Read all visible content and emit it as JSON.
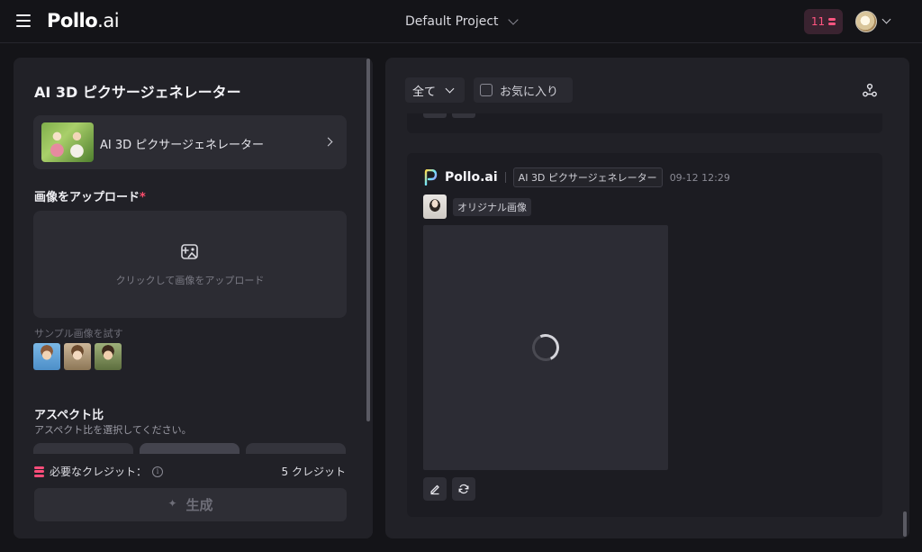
{
  "header": {
    "logo_main": "Pollo",
    "logo_suffix": ".ai",
    "project_name": "Default Project",
    "credits": "11"
  },
  "left_panel": {
    "title": "AI 3D ピクサージェネレーター",
    "tool_card_name": "AI 3D ピクサージェネレーター",
    "upload_label": "画像をアップロード",
    "upload_required_mark": "*",
    "upload_hint": "クリックして画像をアップロード",
    "sample_label": "サンプル画像を試す",
    "aspect_title": "アスペクト比",
    "aspect_subtitle": "アスペクト比を選択してください。",
    "required_credits_label": "必要なクレジット：",
    "required_credits_value": "5 クレジット",
    "generate_label": "生成"
  },
  "right_panel": {
    "filter_value": "全て",
    "favorites_label": "お気に入り",
    "card": {
      "brand": "Pollo.ai",
      "tool_tag": "AI 3D ピクサージェネレーター",
      "timestamp": "09-12 12:29",
      "original_tag": "オリジナル画像"
    }
  },
  "icons": {
    "menu": "hamburger-icon",
    "credit": "coin-stack-icon",
    "upload": "image-add-icon",
    "share": "share-icon",
    "edit": "pencil-icon",
    "regenerate": "refresh-icon",
    "loading": "spinner-icon"
  },
  "colors": {
    "accent": "#ff4d7a",
    "background": "#141418",
    "panel": "#212127"
  }
}
